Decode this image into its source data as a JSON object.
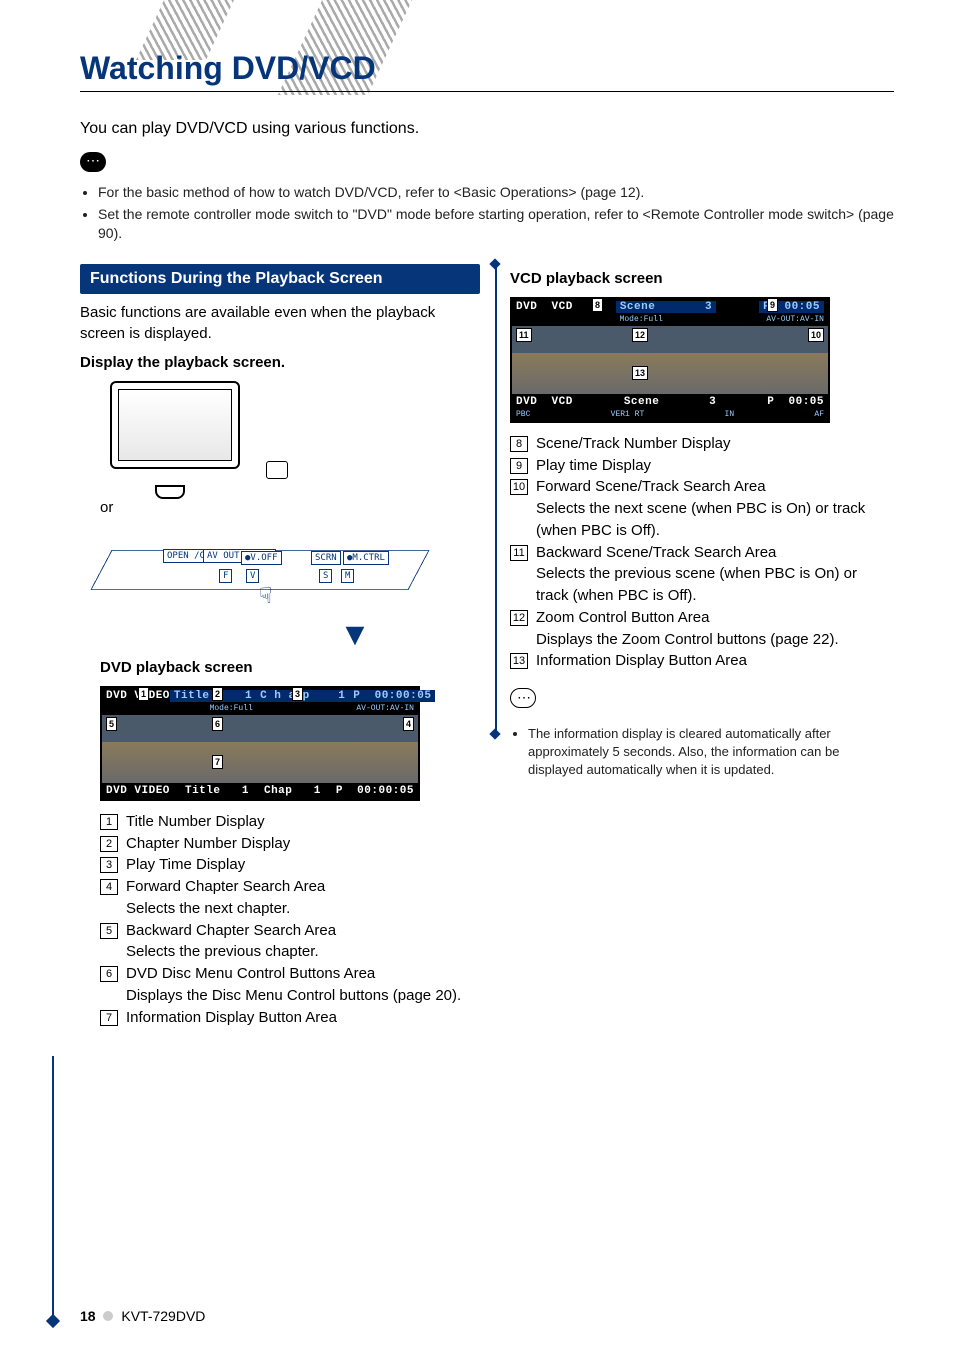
{
  "page": {
    "title": "Watching DVD/VCD",
    "intro": "You can play DVD/VCD using various functions.",
    "notes": [
      "For the basic method of how to watch DVD/VCD, refer to <Basic Operations> (page 12).",
      "Set the remote controller mode switch to \"DVD\" mode before starting operation, refer to <Remote Controller mode switch> (page 90)."
    ]
  },
  "left": {
    "bar": "Functions During the Playback Screen",
    "lead": "Basic functions are available even when the playback screen is displayed.",
    "step": "Display the playback screen.",
    "or": "or",
    "panel_labels": {
      "open": "OPEN\n/CLOSE",
      "avout": "AV OUT\n● SEL",
      "voff": "●V.OFF",
      "scrn": "SCRN",
      "mctrl": "●M.CTRL",
      "f": "F",
      "v": "V",
      "s": "S",
      "m": "M"
    },
    "dvd_heading": "DVD playback screen",
    "dvd_top": {
      "label": "DVD VIDEO",
      "title_lbl": "Title",
      "title_val": "1",
      "chap_lbl": "C h a p",
      "chap_val": "1",
      "time_lbl": "P",
      "time_val": "00:00:05",
      "mode": "Mode:Full",
      "av": "AV-OUT:AV-IN"
    },
    "dvd_bot": {
      "label": "DVD VIDEO",
      "title_lbl": "Title",
      "title_val": "1",
      "chap_lbl": "Chap",
      "chap_val": "1",
      "time": "P  00:00:05"
    },
    "dvd_items": [
      {
        "n": "1",
        "t": "Title Number Display"
      },
      {
        "n": "2",
        "t": "Chapter Number Display"
      },
      {
        "n": "3",
        "t": "Play Time Display"
      },
      {
        "n": "4",
        "t": "Forward Chapter Search Area",
        "d": "Selects the next chapter."
      },
      {
        "n": "5",
        "t": "Backward Chapter Search Area",
        "d": "Selects the previous chapter."
      },
      {
        "n": "6",
        "t": "DVD Disc Menu Control Buttons Area",
        "d": "Displays the Disc Menu Control buttons (page 20)."
      },
      {
        "n": "7",
        "t": "Information Display Button Area"
      }
    ]
  },
  "right": {
    "vcd_heading": "VCD playback screen",
    "vcd_top": {
      "label": "DVD  VCD",
      "scene_lbl": "Scene",
      "scene_val": "3",
      "time_lbl": "P",
      "time_val": "00:05",
      "mode": "Mode:Full",
      "av": "AV-OUT:AV-IN"
    },
    "vcd_bot": {
      "label": "DVD  VCD",
      "scene_lbl": "Scene",
      "scene_val": "3",
      "time": "P  00:05",
      "pbc": "PBC",
      "ver": "VER1",
      "rt": "RT",
      "in": "IN",
      "af": "AF"
    },
    "vcd_items": [
      {
        "n": "8",
        "t": "Scene/Track Number Display"
      },
      {
        "n": "9",
        "t": "Play time Display"
      },
      {
        "n": "10",
        "t": "Forward Scene/Track Search Area",
        "d": "Selects the next scene (when PBC is On) or track (when PBC is Off)."
      },
      {
        "n": "11",
        "t": "Backward Scene/Track Search Area",
        "d": "Selects the previous scene (when PBC is On) or track (when PBC is Off)."
      },
      {
        "n": "12",
        "t": "Zoom Control Button Area",
        "d": "Displays the Zoom Control buttons (page 22)."
      },
      {
        "n": "13",
        "t": "Information Display Button Area"
      }
    ],
    "footnote": "The information display is cleared automatically after approximately 5 seconds. Also, the information can be displayed automatically when it is updated."
  },
  "footer": {
    "page_num": "18",
    "model": "KVT-729DVD"
  }
}
